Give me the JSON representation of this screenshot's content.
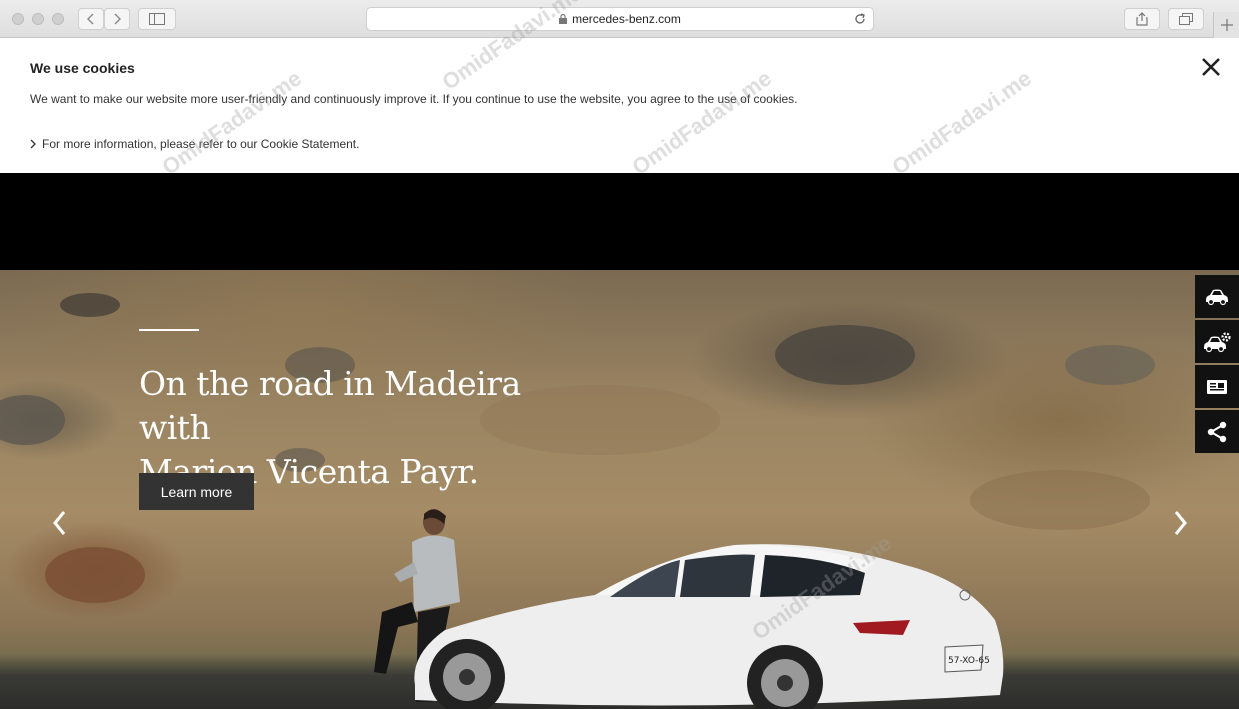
{
  "browser": {
    "url": "mercedes-benz.com",
    "icons": [
      "back-icon",
      "forward-icon",
      "sidebar-icon",
      "lock-icon",
      "reload-icon",
      "share-icon",
      "tabs-icon",
      "new-tab-icon"
    ]
  },
  "cookie_banner": {
    "title": "We use cookies",
    "text": "We want to make our website more user-friendly and continuously improve it. If you continue to use the website, you agree to the use of cookies.",
    "link": "For more information, please refer to our Cookie Statement."
  },
  "hero": {
    "title_line1": "On the road in Madeira with",
    "title_line2": "Marion Vicenta Payr.",
    "button": "Learn more",
    "plate": "57-XO-65"
  },
  "side_tools": [
    {
      "icon": "car-icon"
    },
    {
      "icon": "car-config-icon"
    },
    {
      "icon": "contact-card-icon"
    },
    {
      "icon": "share-icon"
    }
  ],
  "watermark": "OmidFadavi.me",
  "colors": {
    "button_bg": "#333333",
    "sidebar_bg": "#111111",
    "black_bar": "#000000"
  }
}
